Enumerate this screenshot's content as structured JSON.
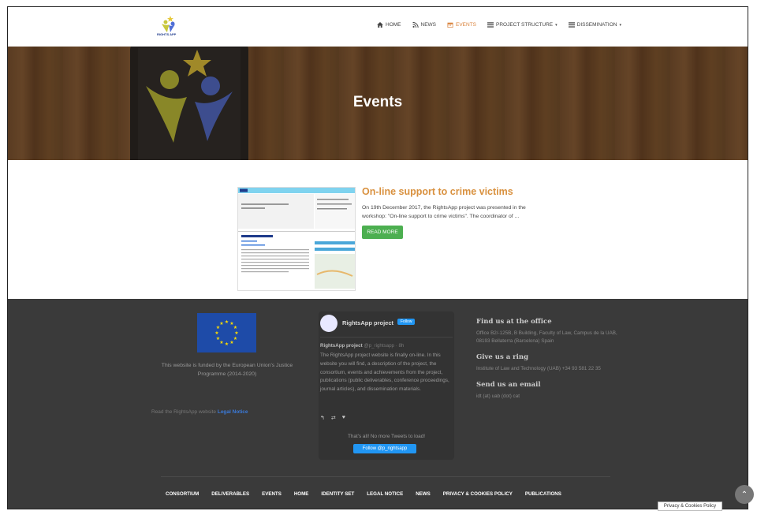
{
  "header": {
    "logo_text": "RIGHTS APP",
    "nav": [
      {
        "label": "Home",
        "icon": "home-icon"
      },
      {
        "label": "News",
        "icon": "rss-icon"
      },
      {
        "label": "Events",
        "icon": "calendar-icon",
        "active": true
      },
      {
        "label": "Project structure",
        "icon": "list-icon",
        "dropdown": true
      },
      {
        "label": "Dissemination",
        "icon": "list-icon",
        "dropdown": true
      }
    ]
  },
  "hero": {
    "title": "Events"
  },
  "event": {
    "title": "On-line support to crime victims",
    "excerpt": "On 19th December 2017, the RightsApp project was presented in the workshop: \"On-line support to crime victims\". The coordinator of ...",
    "button": "READ MORE",
    "thumb_heading": "El apoyo online a las víctimas de delitos",
    "thumb_subheading": "Busca del evento"
  },
  "footer": {
    "funded_text": "This website is funded by the European Union's Justice Programme (2014-2020)",
    "legal_prefix": "Read the RightsApp website",
    "legal_link": "Legal Notice",
    "twitter": {
      "name": "RightsApp project",
      "follow_small": "Follow",
      "handle": "RightsApp project",
      "handle_at": "@p_rightsapp · 8h",
      "tweet": "The RightsApp project website is finally on-line. In this website you will find, a description of the project, the consortium, events and achievements from the project, publications (public deliverables, conference proceedings, journal articles), and dissemination materials.",
      "no_more": "That's all! No more Tweets to load!",
      "follow_button": "Follow @p_rightsapp"
    },
    "contact": {
      "office_title": "Find us at the office",
      "office_text": "Office B2/-125B, B Building, Faculty of Law, Campus de la UAB, 08193 Bellaterra (Barcelona) Spain",
      "ring_title": "Give us a ring",
      "ring_text": "Institute of Law and Technology (UAB) +34 93 581 22 35",
      "email_title": "Send us an email",
      "email_text": "idt (at) uab (dot) cat"
    },
    "nav": [
      "Consortium",
      "Deliverables",
      "Events",
      "Home",
      "Identity set",
      "Legal Notice",
      "News",
      "Privacy & Cookies Policy",
      "Publications"
    ]
  },
  "privacy_badge": "Privacy & Cookies Policy",
  "colors": {
    "accent": "#d9913f",
    "button_green": "#4caf50",
    "footer_bg": "#3a3a3a",
    "twitter_blue": "#2196f3"
  }
}
